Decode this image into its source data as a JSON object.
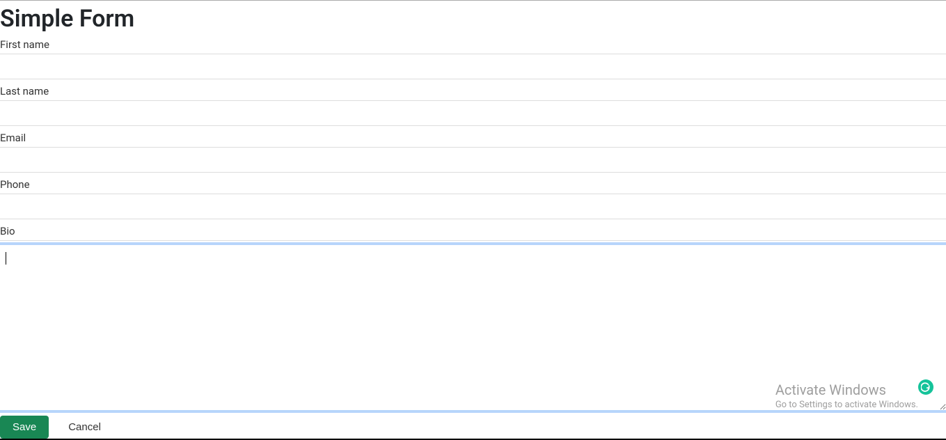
{
  "page": {
    "title": "Simple Form"
  },
  "form": {
    "first_name": {
      "label": "First name",
      "value": ""
    },
    "last_name": {
      "label": "Last name",
      "value": ""
    },
    "email": {
      "label": "Email",
      "value": ""
    },
    "phone": {
      "label": "Phone",
      "value": ""
    },
    "bio": {
      "label": "Bio",
      "value": ""
    }
  },
  "buttons": {
    "save": "Save",
    "cancel": "Cancel"
  },
  "watermark": {
    "title": "Activate Windows",
    "subtitle": "Go to Settings to activate Windows."
  }
}
